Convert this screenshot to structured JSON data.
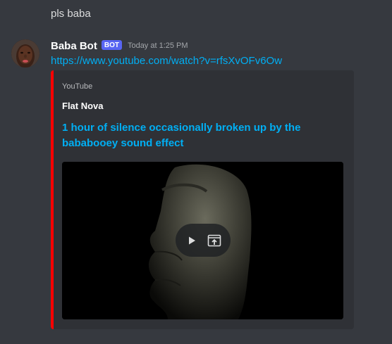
{
  "previous_message": {
    "text": "pls baba"
  },
  "message": {
    "author": {
      "name": "Baba Bot",
      "tag": "BOT",
      "tag_color": "#5865f2",
      "avatar_icon": "avatar-image"
    },
    "timestamp": "Today at 1:25 PM",
    "link": "https://www.youtube.com/watch?v=rfsXvOFv6Ow",
    "embed": {
      "accent_color": "#ff0000",
      "provider": "YouTube",
      "author": "Flat Nova",
      "title": "1 hour of silence occasionally broken up by the bababooey sound effect",
      "video": {
        "controls": [
          {
            "icon": "play-icon"
          },
          {
            "icon": "open-external-icon"
          }
        ]
      }
    }
  }
}
